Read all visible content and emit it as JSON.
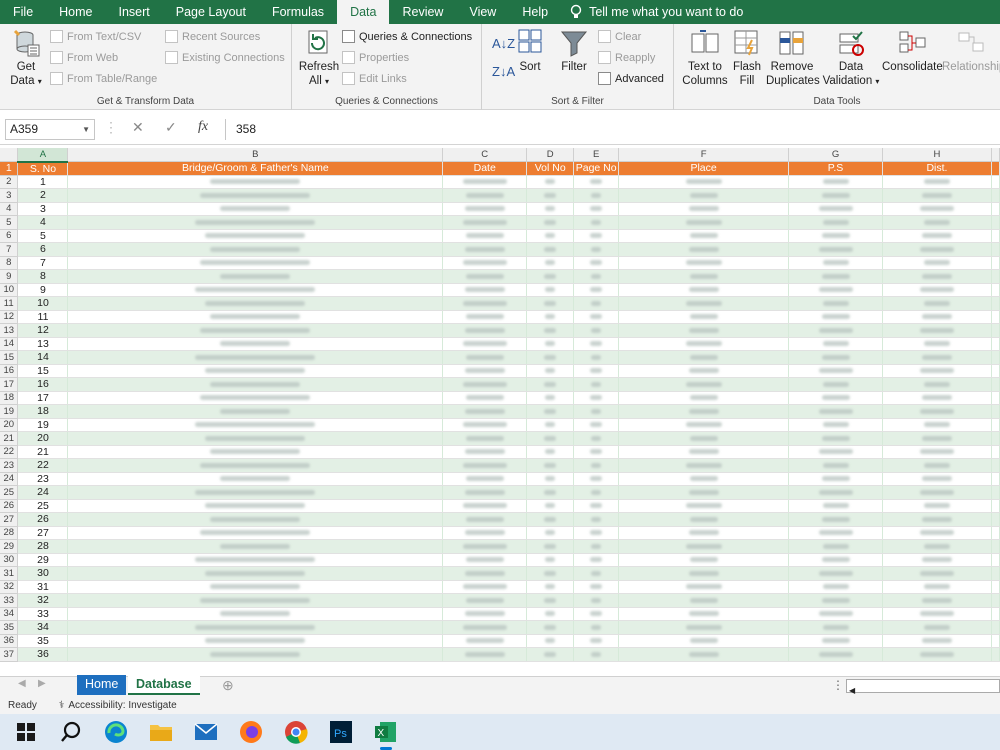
{
  "tabs": [
    "File",
    "Home",
    "Insert",
    "Page Layout",
    "Formulas",
    "Data",
    "Review",
    "View",
    "Help"
  ],
  "tellme": "Tell me what you want to do",
  "ribbon": {
    "get_data": "Get Data",
    "get_transform": {
      "from_text": "From Text/CSV",
      "from_web": "From Web",
      "from_table": "From Table/Range",
      "recent": "Recent Sources",
      "existing": "Existing Connections",
      "label": "Get & Transform Data"
    },
    "queries": {
      "refresh": "Refresh All",
      "qc": "Queries & Connections",
      "properties": "Properties",
      "edit_links": "Edit Links",
      "label": "Queries & Connections"
    },
    "sort_filter": {
      "sort": "Sort",
      "filter": "Filter",
      "clear": "Clear",
      "reapply": "Reapply",
      "advanced": "Advanced",
      "label": "Sort & Filter"
    },
    "tools": {
      "text_to_cols": "Text to Columns",
      "flash_fill": "Flash Fill",
      "remove_dup": "Remove Duplicates",
      "validation": "Data Validation",
      "consolidate": "Consolidate",
      "relationships": "Relationships",
      "label": "Data Tools"
    }
  },
  "formula_bar": {
    "namebox": "A359",
    "value": "358",
    "fx": "fx"
  },
  "columns": [
    "A",
    "B",
    "C",
    "D",
    "E",
    "F",
    "G",
    "H"
  ],
  "header_row": [
    "S. No",
    "Bridge/Groom & Father's Name",
    "Date",
    "Vol No",
    "Page No",
    "Place",
    "P.S",
    "Dist."
  ],
  "rows": [
    "1",
    "2",
    "3",
    "4",
    "5",
    "6",
    "7",
    "8",
    "9",
    "10",
    "11",
    "12",
    "13",
    "14",
    "15",
    "16",
    "17",
    "18",
    "19",
    "20",
    "21",
    "22",
    "23",
    "24",
    "25",
    "26",
    "27",
    "28",
    "29",
    "30",
    "31",
    "32",
    "33",
    "34",
    "35",
    "36"
  ],
  "row_numbers": [
    "1",
    "2",
    "3",
    "4",
    "5",
    "6",
    "7",
    "8",
    "9",
    "10",
    "11",
    "12",
    "13",
    "14",
    "15",
    "16",
    "17",
    "18",
    "19",
    "20",
    "21",
    "22",
    "23",
    "24",
    "25",
    "26",
    "27",
    "28",
    "29",
    "30",
    "31",
    "32",
    "33",
    "34",
    "35",
    "36",
    "37"
  ],
  "sheet_tabs": [
    "Home",
    "Database"
  ],
  "status": {
    "ready": "Ready",
    "accessibility": "Accessibility: Investigate"
  },
  "taskbar": [
    "windows",
    "search",
    "edge",
    "explorer",
    "mail",
    "firefox",
    "chrome",
    "photoshop",
    "excel"
  ],
  "colors": {
    "brand": "#217346",
    "header_fill": "#ed7d31",
    "band": "#e3f0e5"
  }
}
